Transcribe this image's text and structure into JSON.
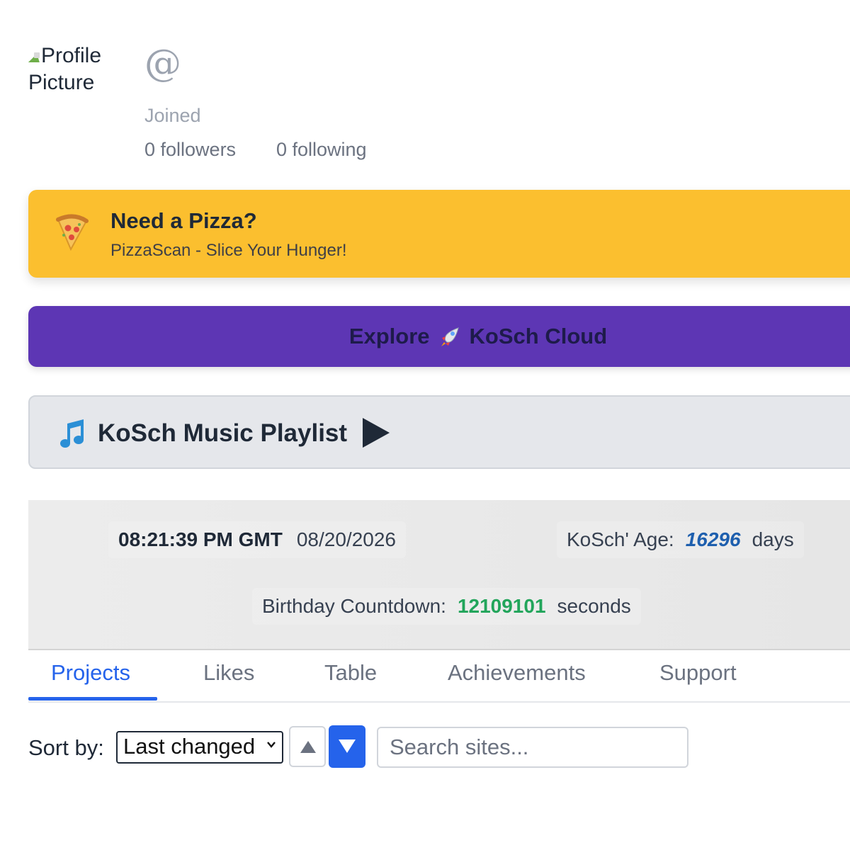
{
  "profile": {
    "picture_alt_line1": "Profile",
    "picture_alt_line2": "Picture",
    "handle": "@",
    "joined": "Joined",
    "followers": "0 followers",
    "following": "0 following"
  },
  "ad": {
    "title": "Need a Pizza?",
    "subtitle": "PizzaScan - Slice Your Hunger!",
    "icon": "pizza-icon",
    "color": "#fbbf2f"
  },
  "explore": {
    "label_before": "Explore",
    "label_after": "KoSch Cloud",
    "icon": "rocket-icon",
    "color": "#5d36b4"
  },
  "music": {
    "title": "KoSch Music Playlist",
    "icon": "music-note-icon"
  },
  "clock": {
    "time": "08:21:39 PM GMT",
    "date": "08/20/2026",
    "age_label": "KoSch' Age:",
    "age_value": "16296",
    "age_unit": "days",
    "countdown_label": "Birthday Countdown:",
    "countdown_value": "12109101",
    "countdown_unit": "seconds"
  },
  "tabs": [
    {
      "label": "Projects",
      "active": true
    },
    {
      "label": "Likes",
      "active": false
    },
    {
      "label": "Table",
      "active": false
    },
    {
      "label": "Achievements",
      "active": false
    },
    {
      "label": "Support",
      "active": false
    }
  ],
  "sort": {
    "label": "Sort by:",
    "selected": "Last changed",
    "search_placeholder": "Search sites..."
  }
}
